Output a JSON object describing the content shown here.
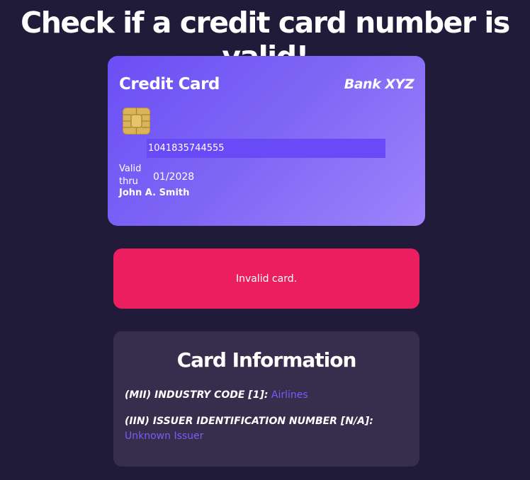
{
  "page": {
    "title": "Check if a credit card number is valid!"
  },
  "card": {
    "title": "Credit Card",
    "bank": "Bank XYZ",
    "number": "1041835744555",
    "valid_label": "Valid thru",
    "expiry": "01/2028",
    "holder": "John A. Smith",
    "chip_color": "#d9b45a"
  },
  "status": {
    "message": "Invalid card.",
    "color": "#eb1f60"
  },
  "info": {
    "title": "Card Information",
    "mii_label": "(MII) INDUSTRY CODE [1]:",
    "mii_value": "Airlines",
    "iin_label": "(IIN) ISSUER IDENTIFICATION NUMBER [N/A]:",
    "iin_value": "Unknown Issuer",
    "value_color": "#7b5cf6"
  }
}
